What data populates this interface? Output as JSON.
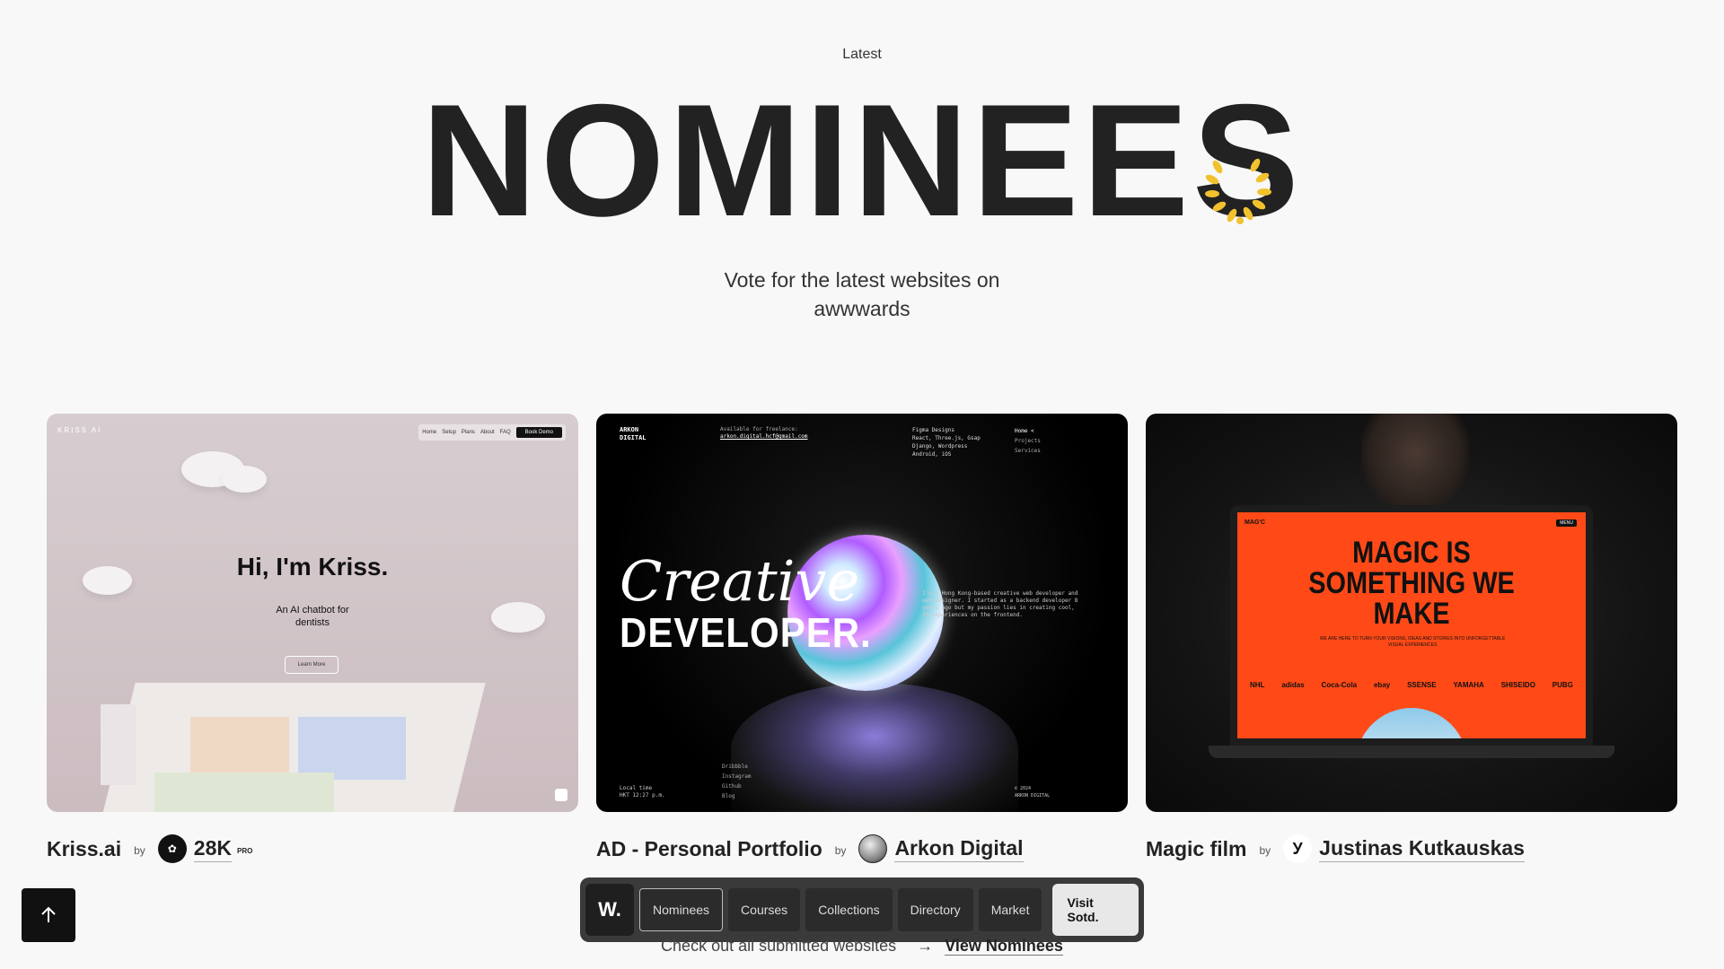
{
  "header": {
    "eyebrow": "Latest",
    "title": "NOMINEES",
    "subtitle": "Vote for the latest websites on awwwards"
  },
  "cards": [
    {
      "title": "Kriss.ai",
      "by": "by",
      "author": "28K",
      "badge": "PRO",
      "thumb": {
        "brand": "KRISS AI",
        "nav": [
          "Home",
          "Setup",
          "Plans",
          "About",
          "FAQ"
        ],
        "cta": "Book Demo",
        "headline": "Hi, I'm Kriss.",
        "sub_line1": "An AI chatbot for",
        "sub_line2": "dentists",
        "learn": "Learn More"
      }
    },
    {
      "title": "AD - Personal Portfolio",
      "by": "by",
      "author": "Arkon Digital",
      "thumb": {
        "logo_line1": "ARKON",
        "logo_line2": "DIGITAL",
        "freelance_label": "Available for freelance:",
        "email": "arkon.digital.hcf@gmail.com",
        "skills": [
          "Figma Designs",
          "React, Three.js, Gsap",
          "Django, Wordpress",
          "Android, iOS"
        ],
        "menu": [
          "Home <",
          "Projects",
          "Services"
        ],
        "creative": "Creative",
        "developer": "DEVELOPER.",
        "about": "I'm a Hong Kong-based creative web developer and web designer. I started as a backend developer 8 years ago but my passion lies in creating cool, 3D experiences on the frontend.",
        "social": [
          "Dribbble",
          "Instagram",
          "Github",
          "Blog"
        ],
        "time_label": "Local time",
        "time": "HKT 12:27 p.m.",
        "copy_line1": "© 2024",
        "copy_line2": "ARKON DIGITAL"
      }
    },
    {
      "title": "Magic film",
      "by": "by",
      "author": "Justinas Kutkauskas",
      "thumb": {
        "brand": "MAG'C",
        "menu": "MENU",
        "headline_1": "MAGIC IS",
        "headline_2": "SOMETHING WE",
        "headline_3": "MAKE",
        "small": "WE ARE HERE TO TURN YOUR VISIONS, IDEAS AND STORIES INTO UNFORGETTABLE VISUAL EXPERIENCES",
        "logos": [
          "NHL",
          "adidas",
          "Coca-Cola",
          "ebay",
          "SSENSE",
          "YAMAHA",
          "SHISEIDO",
          "PUBG"
        ]
      }
    }
  ],
  "dock": {
    "logo": "W.",
    "tabs": [
      "Nominees",
      "Courses",
      "Collections",
      "Directory",
      "Market"
    ],
    "visit": "Visit Sotd."
  },
  "footer": {
    "text": "Check out all submitted websites",
    "link": "View Nominees"
  },
  "colors": {
    "background": "#f8f8f8",
    "text": "#222222",
    "laurel": "#f2c12e",
    "magic_orange": "#ff4a17"
  },
  "icons": [
    "laurel-icon",
    "arrow-up-icon",
    "arrow-right-icon"
  ]
}
